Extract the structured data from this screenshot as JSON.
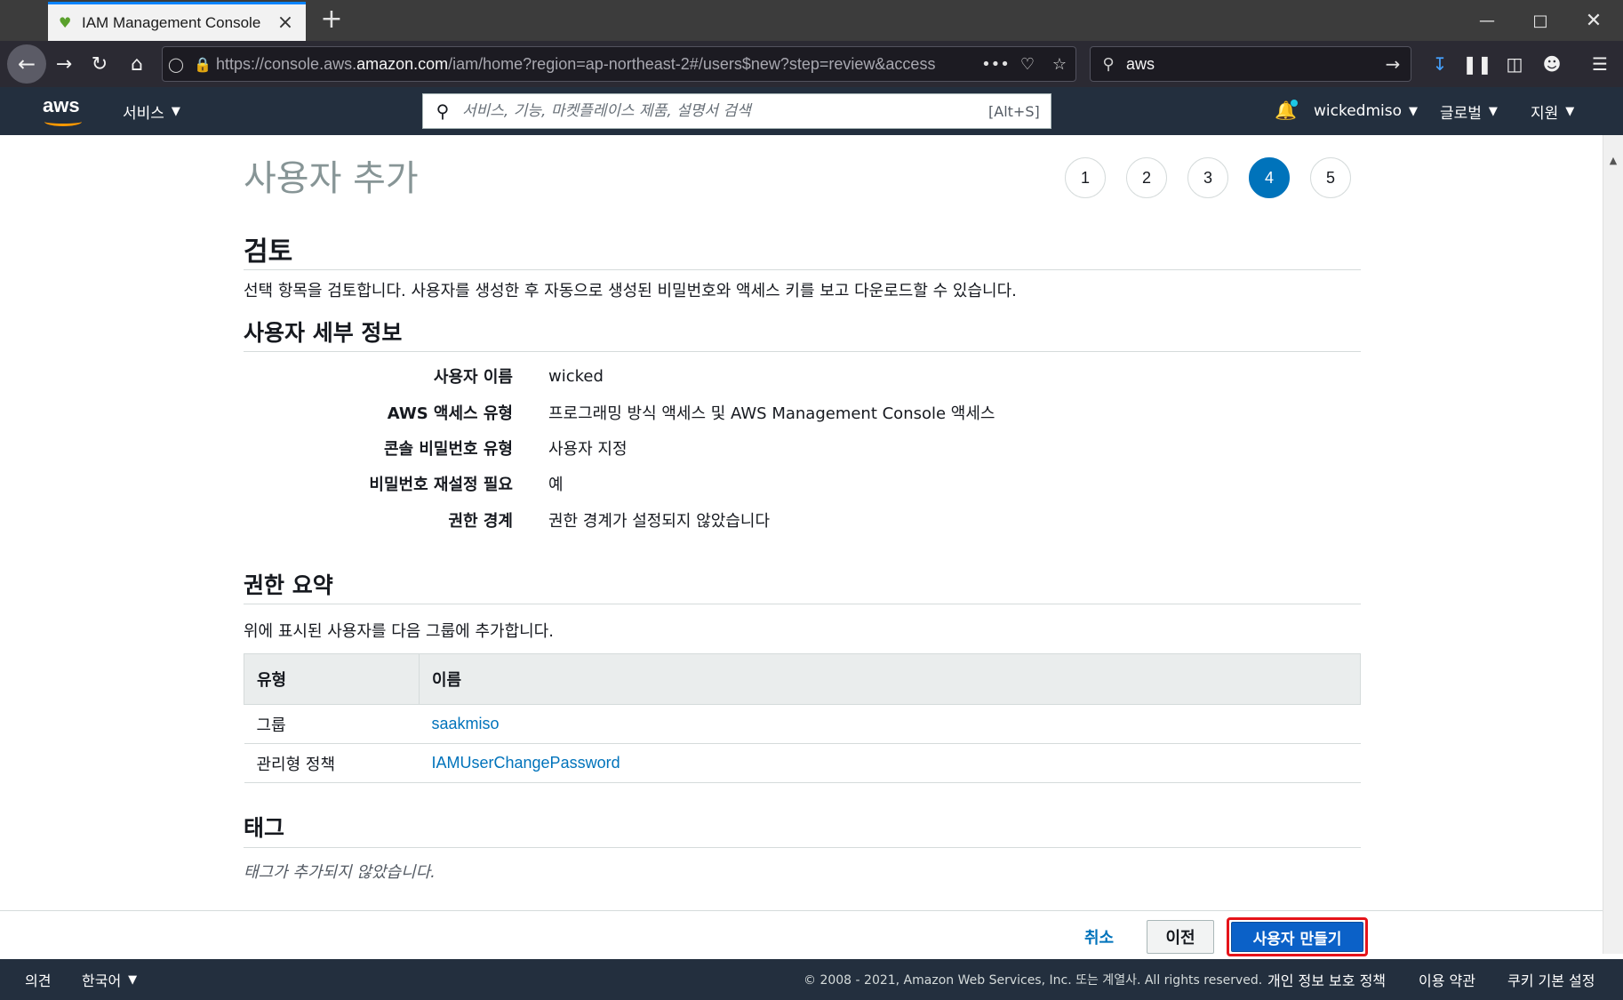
{
  "browser": {
    "tab_title": "IAM Management Console",
    "url_prefix": "https://console.aws.",
    "url_domain": "amazon.com",
    "url_path": "/iam/home?region=ap-northeast-2#/users$new?step=review&access",
    "search_value": "aws"
  },
  "aws_header": {
    "logo_text": "aws",
    "services_label": "서비스",
    "search_placeholder": "서비스, 기능, 마켓플레이스 제품, 설명서 검색",
    "search_shortcut": "[Alt+S]",
    "account_label": "wickedmiso",
    "region_label": "글로벌",
    "support_label": "지원",
    "accent_color": "#ff9900"
  },
  "page": {
    "title": "사용자 추가",
    "steps": [
      "1",
      "2",
      "3",
      "4",
      "5"
    ],
    "active_step": "4",
    "review_heading": "검토",
    "review_description": "선택 항목을 검토합니다. 사용자를 생성한 후 자동으로 생성된 비밀번호와 액세스 키를 보고 다운로드할 수 있습니다.",
    "details_heading": "사용자 세부 정보",
    "details": [
      {
        "label": "사용자 이름",
        "value": "wicked"
      },
      {
        "label": "AWS 액세스 유형",
        "value": "프로그래밍 방식 액세스 및 AWS Management Console 액세스"
      },
      {
        "label": "콘솔 비밀번호 유형",
        "value": "사용자 지정"
      },
      {
        "label": "비밀번호 재설정 필요",
        "value": "예"
      },
      {
        "label": "권한 경계",
        "value": "권한 경계가 설정되지 않았습니다"
      }
    ],
    "permissions_heading": "권한 요약",
    "permissions_description": "위에 표시된 사용자를 다음 그룹에 추가합니다.",
    "permissions_table": {
      "headers": [
        "유형",
        "이름"
      ],
      "rows": [
        {
          "type": "그룹",
          "name": "saakmiso"
        },
        {
          "type": "관리형 정책",
          "name": "IAMUserChangePassword"
        }
      ]
    },
    "tags_heading": "태그",
    "tags_empty": "태그가 추가되지 않았습니다."
  },
  "actions": {
    "cancel_label": "취소",
    "previous_label": "이전",
    "create_label": "사용자 만들기",
    "highlight_color": "#e5141a"
  },
  "footer": {
    "feedback_label": "의견",
    "language_label": "한국어",
    "copyright": "© 2008 - 2021, Amazon Web Services, Inc. 또는 계열사. All rights reserved.",
    "privacy_label": "개인 정보 보호 정책",
    "terms_label": "이용 약관",
    "cookie_label": "쿠키 기본 설정"
  }
}
